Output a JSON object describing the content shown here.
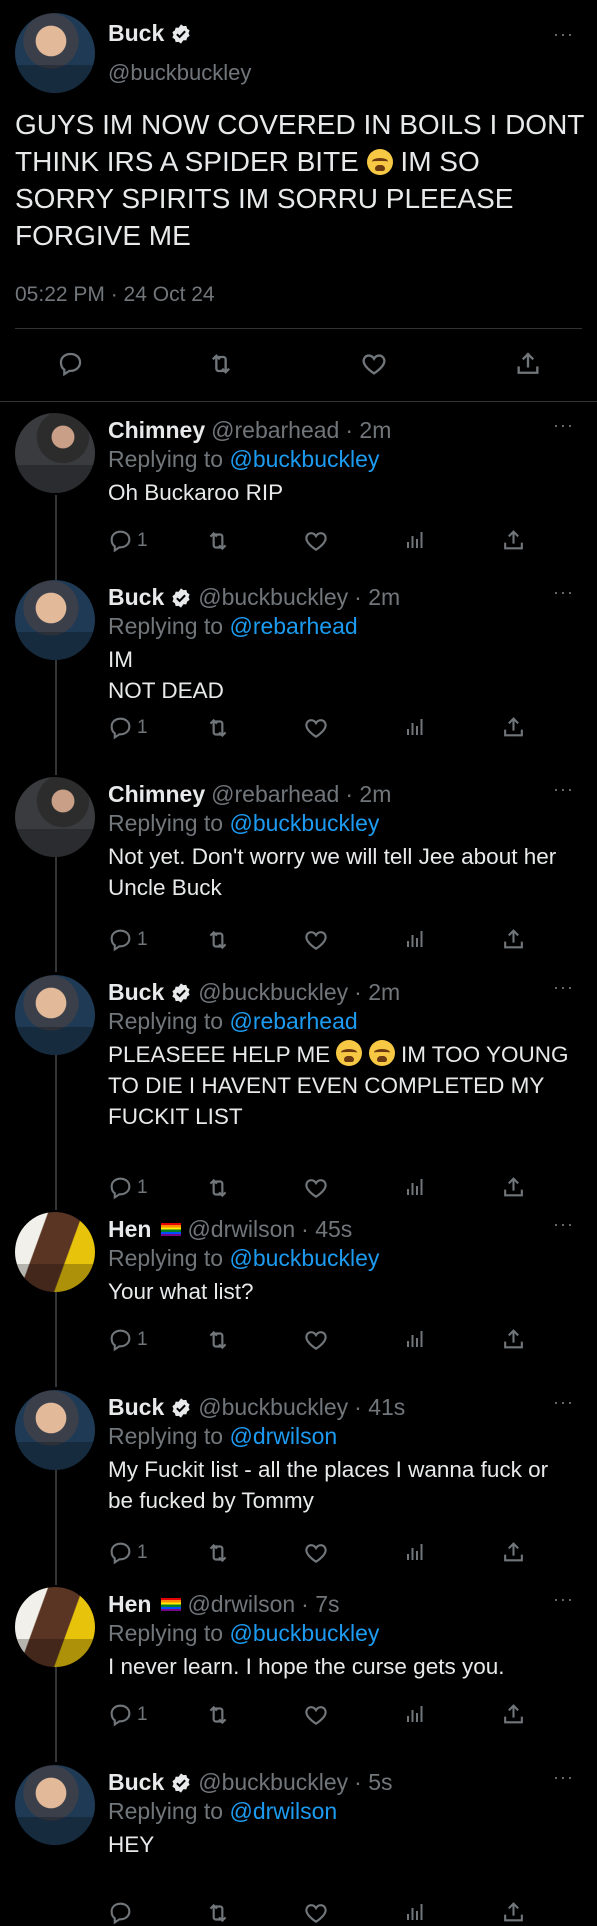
{
  "main_tweet": {
    "name": "Buck",
    "handle": "@buckbuckley",
    "text_parts": [
      "GUYS IM NOW COVERED IN BOILS I DONT THINK IRS A SPIDER BITE ",
      " IM SO SORRY SPIRITS IM SORRU PLEEASE FORGIVE ME"
    ],
    "emoji": "loudly-crying-face",
    "timestamp": "05:22 PM · 24 Oct 24",
    "more": "···"
  },
  "replies": [
    {
      "name": "Chimney",
      "handle": "@rebarhead",
      "time": "· 2m",
      "replying_prefix": "Replying to ",
      "replying_to": "@buckbuckley",
      "text": "Oh Buckaroo RIP",
      "reply_count": "1",
      "verified": false,
      "avatar": "chimney"
    },
    {
      "name": "Buck",
      "handle": "@buckbuckley",
      "time": "· 2m",
      "replying_prefix": "Replying to ",
      "replying_to": "@rebarhead",
      "text": "IM\nNOT DEAD",
      "reply_count": "1",
      "verified": true,
      "avatar": "buck"
    },
    {
      "name": "Chimney",
      "handle": "@rebarhead",
      "time": "· 2m",
      "replying_prefix": "Replying to ",
      "replying_to": "@buckbuckley",
      "text": "Not yet. Don't worry we will tell Jee about her Uncle Buck",
      "reply_count": "1",
      "verified": false,
      "avatar": "chimney"
    },
    {
      "name": "Buck",
      "handle": "@buckbuckley",
      "time": "· 2m",
      "replying_prefix": "Replying to ",
      "replying_to": "@rebarhead",
      "text_parts": [
        "PLEASEEE HELP ME ",
        "  IM TOO YOUNG TO DIE I HAVENT EVEN COMPLETED MY FUCKIT LIST"
      ],
      "emojis": 2,
      "reply_count": "1",
      "verified": true,
      "avatar": "buck"
    },
    {
      "name": "Hen",
      "handle": "@drwilson",
      "time": "· 45s",
      "replying_prefix": "Replying to ",
      "replying_to": "@buckbuckley",
      "text": "Your what list?",
      "reply_count": "1",
      "verified": false,
      "pride_flag": true,
      "avatar": "hen"
    },
    {
      "name": "Buck",
      "handle": "@buckbuckley",
      "time": "· 41s",
      "replying_prefix": "Replying to ",
      "replying_to": "@drwilson",
      "text": "My Fuckit list - all the places I wanna fuck or be fucked by Tommy",
      "reply_count": "1",
      "verified": true,
      "avatar": "buck"
    },
    {
      "name": "Hen",
      "handle": "@drwilson",
      "time": "· 7s",
      "replying_prefix": "Replying to ",
      "replying_to": "@buckbuckley",
      "text": "I never learn. I hope the curse gets you.",
      "reply_count": "1",
      "verified": false,
      "pride_flag": true,
      "avatar": "hen"
    },
    {
      "name": "Buck",
      "handle": "@buckbuckley",
      "time": "· 5s",
      "replying_prefix": "Replying to ",
      "replying_to": "@drwilson",
      "text": "HEY",
      "reply_count": "",
      "verified": true,
      "avatar": "buck"
    }
  ],
  "colors": {
    "background": "#000000",
    "text": "#e7e9ea",
    "secondary": "#71767b",
    "link": "#1d9bf0",
    "verified": "#e7e9ea",
    "divider": "#2f3336"
  },
  "icons": [
    "reply-icon",
    "retweet-icon",
    "like-icon",
    "views-icon",
    "share-icon",
    "verified-badge-icon",
    "more-icon"
  ]
}
